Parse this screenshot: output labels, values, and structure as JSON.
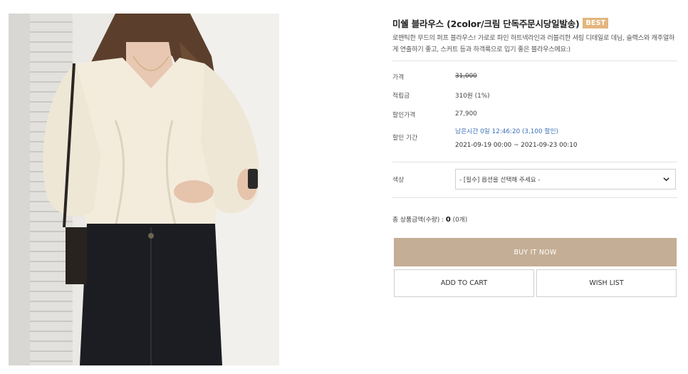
{
  "product": {
    "title": "미쉘 블라우스 (2color/크림 단독주문시당일발송)",
    "badge": "BEST",
    "description": "로맨틱한 무드의 퍼프 블라우스! 가로로 파인 하트넥라인과 러블리한 셔링 디테일로 데님, 슬랙스와 캐주얼하게 연출하기 좋고, 스커트 등과 하객룩으로 입기 좋은 블라우스에요:)",
    "image_alt": "cream puff-sleeve blouse worn with black jeans"
  },
  "details": {
    "price_label": "가격",
    "price_value": "31,000",
    "points_label": "적립금",
    "points_value": "310원 (1%)",
    "sale_price_label": "할인가격",
    "sale_price_value": "27,900",
    "period_label": "할인 기간",
    "period_remaining": "남은시간 0일 12:46:20 (3,100 할인)",
    "period_range": "2021-09-19 00:00 ~ 2021-09-23 00:10"
  },
  "option": {
    "label": "색상",
    "placeholder": "- [필수] 옵션을 선택해 주세요 -"
  },
  "total": {
    "label": "총 상품금액(수량) :",
    "amount": "0",
    "count": "(0개)"
  },
  "buttons": {
    "buy_now": "BUY IT NOW",
    "add_to_cart": "ADD TO CART",
    "wish_list": "WISH LIST"
  },
  "colors": {
    "badge": "#e3b57d",
    "buy_button": "#c4ae95",
    "remaining_time": "#3b6fb6"
  }
}
